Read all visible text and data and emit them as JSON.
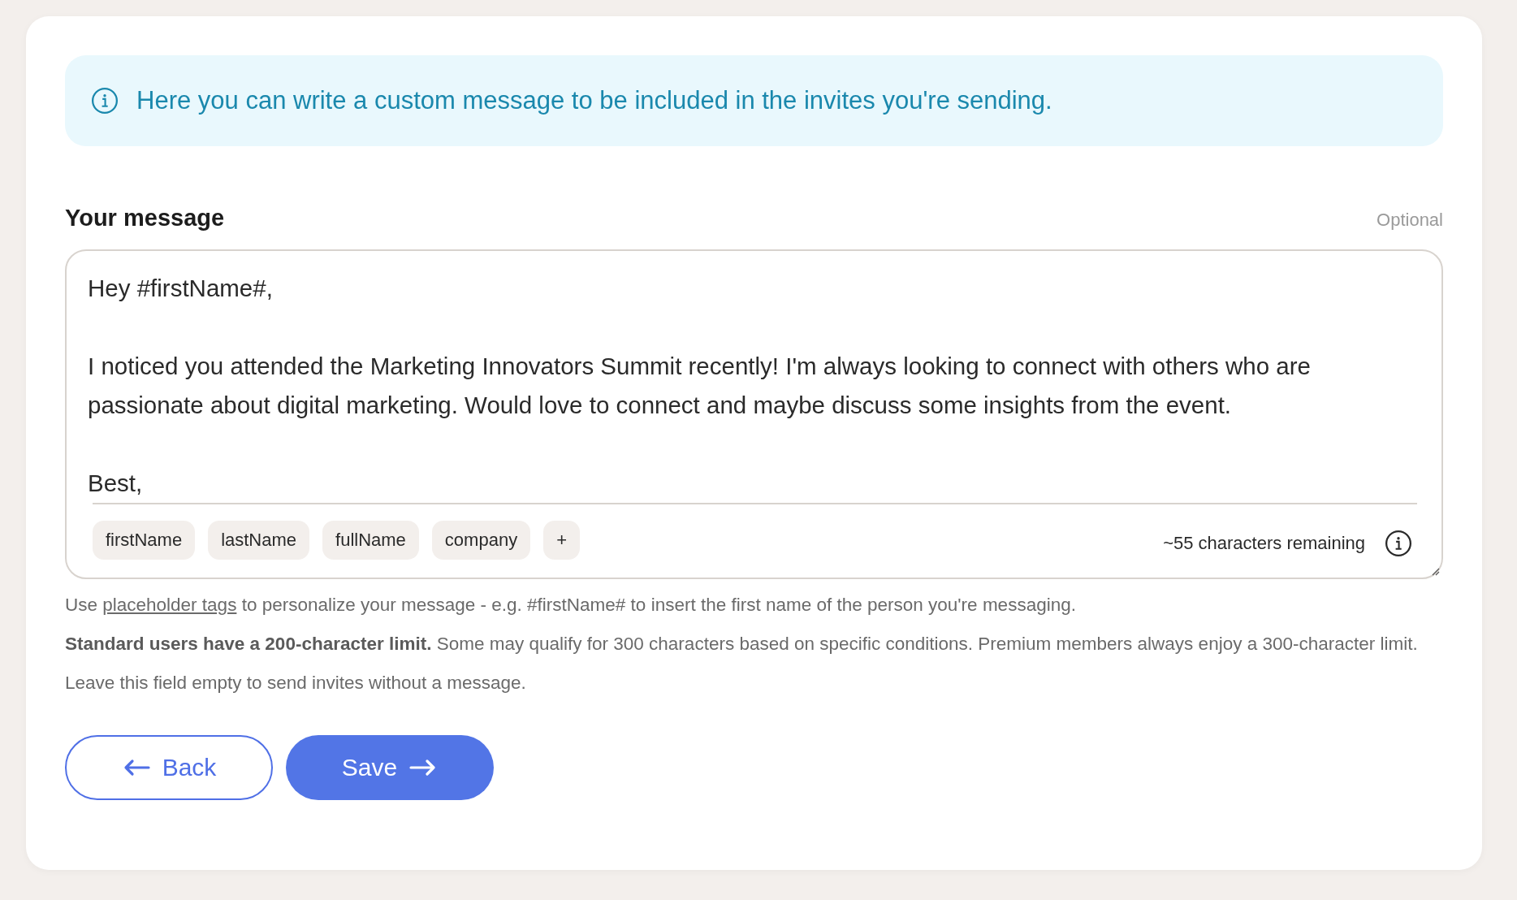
{
  "banner": {
    "text": "Here you can write a custom message to be included in the invites you're sending."
  },
  "message": {
    "label": "Your message",
    "optional_note": "Optional",
    "value": "Hey #firstName#,\n\nI noticed you attended the Marketing Innovators Summit recently! I'm always looking to connect with others who are passionate about digital marketing. Would love to connect and maybe discuss some insights from the event.\n\nBest,",
    "tags": [
      "firstName",
      "lastName",
      "fullName",
      "company",
      "+"
    ],
    "counter": "~55 characters remaining"
  },
  "help": [
    {
      "kind": "link_line",
      "before": "Use ",
      "link": "placeholder tags",
      "after": " to personalize your message - e.g. #firstName# to insert the first name of the person you're messaging."
    },
    {
      "kind": "text",
      "text": "**Standard users have a 200-character limit.** Some may qualify for 300 characters based on specific conditions. Premium members always enjoy a 300-character limit."
    },
    {
      "kind": "text",
      "text": "Leave this field empty to send invites without a message."
    }
  ],
  "buttons": [
    {
      "kind": "back",
      "label": "Back"
    },
    {
      "kind": "save",
      "label": "Save"
    }
  ]
}
